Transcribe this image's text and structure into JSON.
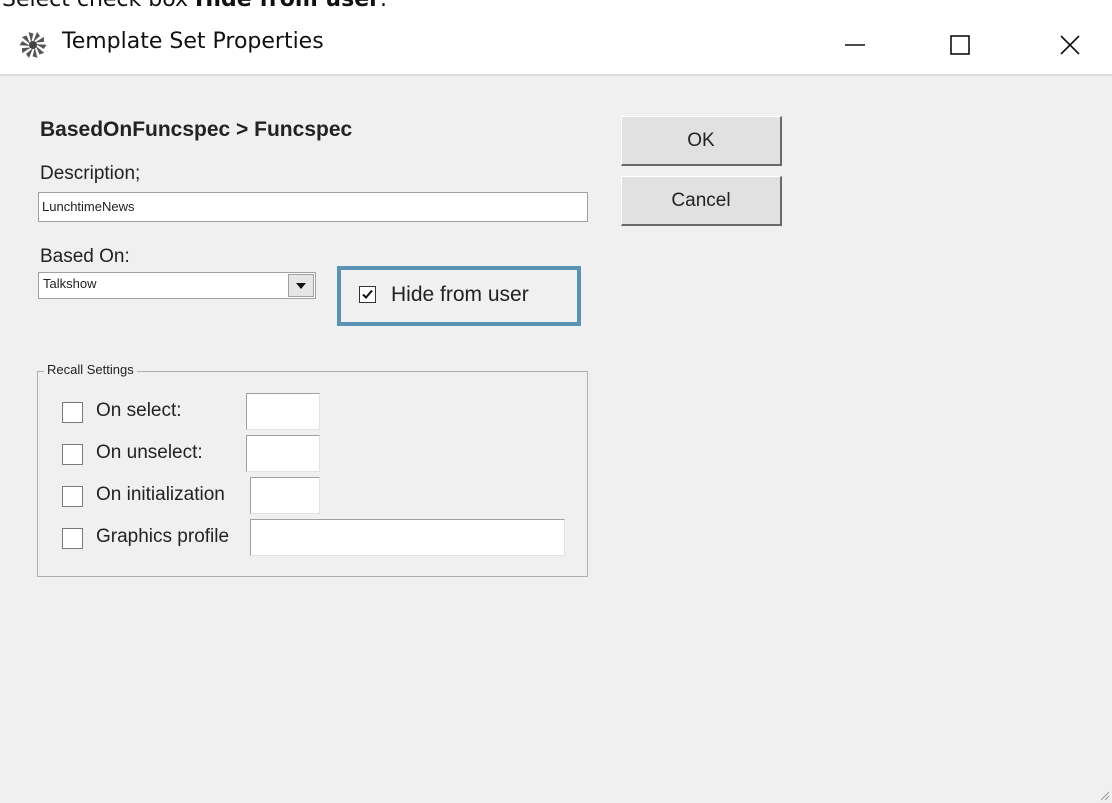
{
  "instruction": {
    "prefix": "Select check box ",
    "target": "Hide from user",
    "suffix": "."
  },
  "window": {
    "title": "Template Set Properties",
    "icons": {
      "app": "pinwheel-icon",
      "minimize": "minimize-icon",
      "maximize": "maximize-icon",
      "close": "close-icon"
    }
  },
  "dialog": {
    "heading": "BasedOnFuncspec > Funcspec",
    "description_label": "Description;",
    "description_value": "LunchtimeNews",
    "based_on_label": "Based On:",
    "based_on_value": "Talkshow",
    "hide_from_user": {
      "label": "Hide from user",
      "checked": true
    },
    "ok_label": "OK",
    "cancel_label": "Cancel",
    "recall_settings": {
      "legend": "Recall Settings",
      "rows": [
        {
          "label": "On select:",
          "checked": false,
          "value": ""
        },
        {
          "label": "On unselect:",
          "checked": false,
          "value": ""
        },
        {
          "label": "On initialization",
          "checked": false,
          "value": ""
        },
        {
          "label": "Graphics profile",
          "checked": false,
          "value": ""
        }
      ]
    }
  },
  "colors": {
    "dialog_bg": "#f0f0f0",
    "highlight": "#5b93b6",
    "title_bg": "#ffffff"
  }
}
